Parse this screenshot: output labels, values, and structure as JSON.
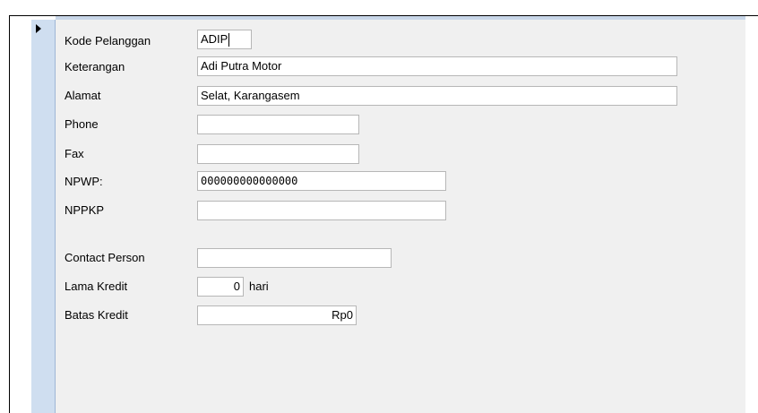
{
  "form": {
    "fields": {
      "kode_pelanggan": {
        "label": "Kode Pelanggan",
        "value": "ADIP"
      },
      "keterangan": {
        "label": "Keterangan",
        "value": "Adi Putra Motor"
      },
      "alamat": {
        "label": "Alamat",
        "value": "Selat, Karangasem"
      },
      "phone": {
        "label": "Phone",
        "value": ""
      },
      "fax": {
        "label": "Fax",
        "value": ""
      },
      "npwp": {
        "label": "NPWP:",
        "value": "000000000000000"
      },
      "nppkp": {
        "label": "NPPKP",
        "value": ""
      },
      "contact_person": {
        "label": "Contact Person",
        "value": ""
      },
      "lama_kredit": {
        "label": "Lama Kredit",
        "value": "0",
        "unit": "hari"
      },
      "batas_kredit": {
        "label": "Batas Kredit",
        "value": "Rp0"
      }
    }
  },
  "colors": {
    "record_selector": "#cfdef0",
    "detail_background": "#f0f0f0",
    "field_border": "#b7b7b7"
  },
  "icons": {
    "record_indicator": "current-record-arrow-icon"
  }
}
